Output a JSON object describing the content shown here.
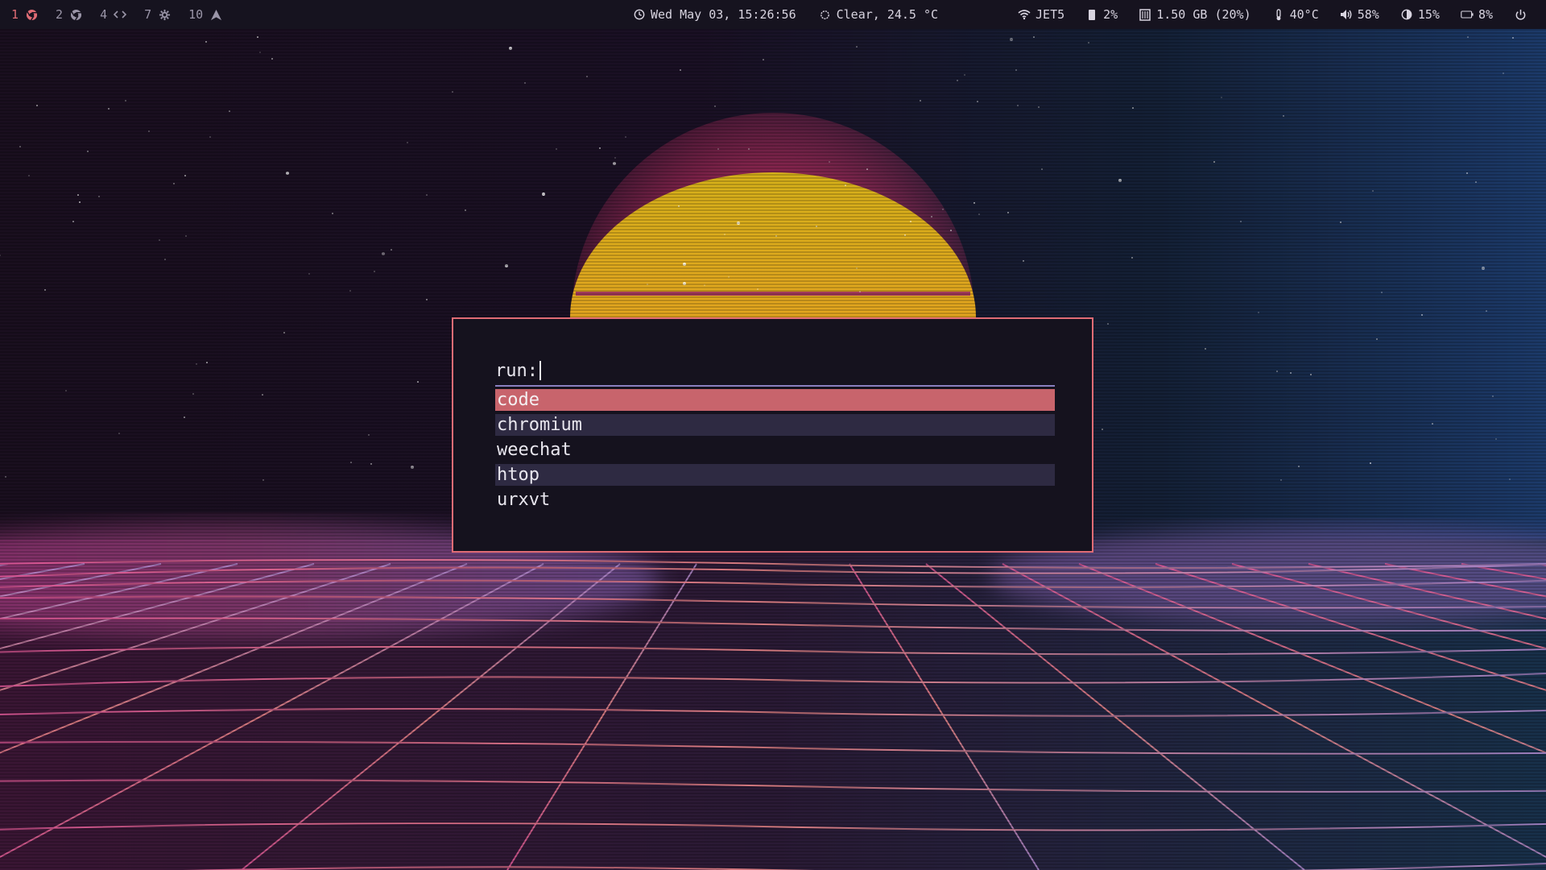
{
  "colors": {
    "bar_bg": "#16131f",
    "accent": "#e06c75",
    "launcher_bg": "#15121e",
    "selected_bg": "#c8646c",
    "alt_row_bg": "#2e2a42",
    "prompt_underline": "#8a7fc0",
    "sun": "#e5b61d"
  },
  "topbar": {
    "workspaces": [
      {
        "number": "1",
        "icon": "chrome-icon",
        "active": true
      },
      {
        "number": "2",
        "icon": "chrome-icon",
        "active": false
      },
      {
        "number": "4",
        "icon": "code-icon",
        "active": false
      },
      {
        "number": "7",
        "icon": "gear-icon",
        "active": false
      },
      {
        "number": "10",
        "icon": "arch-icon",
        "active": false
      }
    ],
    "clock": {
      "icon": "clock-icon",
      "text": "Wed May 03, 15:26:56"
    },
    "weather": {
      "icon": "sun-icon",
      "text": "Clear, 24.5 °C"
    },
    "wifi": {
      "icon": "wifi-icon",
      "text": "JET5"
    },
    "cpu": {
      "icon": "cpu-icon",
      "text": "2%"
    },
    "memory": {
      "icon": "memory-icon",
      "text": "1.50 GB (20%)"
    },
    "temperature": {
      "icon": "thermometer-icon",
      "text": "40°C"
    },
    "volume": {
      "icon": "volume-icon",
      "text": "58%"
    },
    "brightness": {
      "icon": "brightness-icon",
      "text": "15%"
    },
    "battery": {
      "icon": "battery-icon",
      "text": "8%"
    },
    "power": {
      "icon": "power-icon"
    }
  },
  "launcher": {
    "prompt": "run:",
    "query": "",
    "results": [
      {
        "label": "code",
        "state": "selected"
      },
      {
        "label": "chromium",
        "state": "alt"
      },
      {
        "label": "weechat",
        "state": "normal"
      },
      {
        "label": "htop",
        "state": "alt"
      },
      {
        "label": "urxvt",
        "state": "normal"
      }
    ]
  }
}
